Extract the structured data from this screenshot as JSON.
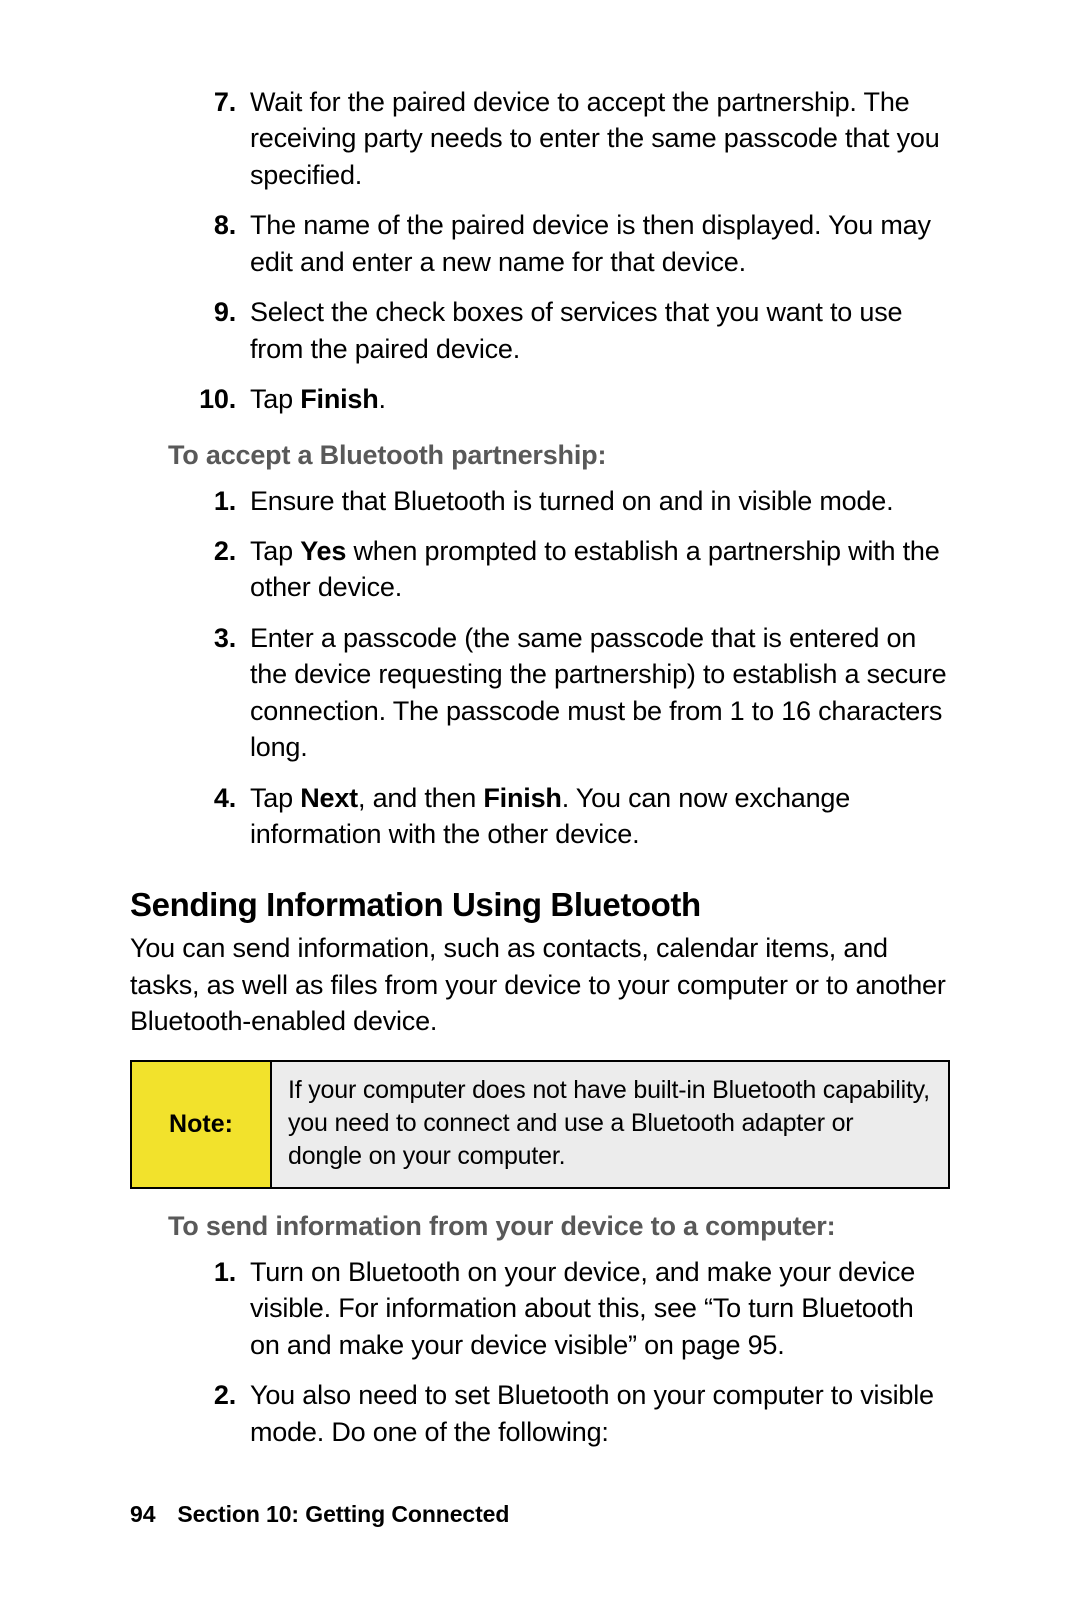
{
  "list1": [
    {
      "n": "7.",
      "t": "Wait for the paired device to accept the partnership. The receiving party needs to enter the same passcode that you specified."
    },
    {
      "n": "8.",
      "t": "The name of the paired device is then displayed.  You may edit and enter a new name for that device."
    },
    {
      "n": "9.",
      "t": "Select the check boxes of services that you want to use from the paired device."
    }
  ],
  "list1_last": {
    "n": "10.",
    "pre": "Tap ",
    "bold": "Finish",
    "post": "."
  },
  "sub1": "To accept a Bluetooth partnership:",
  "list2": {
    "i1": {
      "n": "1.",
      "t": "Ensure that Bluetooth is turned on and in visible mode."
    },
    "i2": {
      "n": "2.",
      "pre": "Tap ",
      "b1": "Yes",
      "post": " when prompted to establish a partnership with the other device."
    },
    "i3": {
      "n": "3.",
      "t": "Enter a passcode (the same passcode that is entered on the device requesting the partnership) to establish a secure connection. The passcode must be from 1 to 16 characters long."
    },
    "i4": {
      "n": "4.",
      "pre": "Tap ",
      "b1": "Next",
      "mid": ", and then ",
      "b2": "Finish",
      "post": ". You can now exchange information with the other device."
    }
  },
  "h2": "Sending Information Using Bluetooth",
  "p1": "You can send information, such as contacts, calendar items, and tasks, as well as files from your device to your computer or to another Bluetooth-enabled device.",
  "note": {
    "label": "Note:",
    "body": "If your computer does not have built-in Bluetooth capability, you need to connect and use a Bluetooth adapter or dongle on your computer."
  },
  "sub2": "To send information from your device to a computer:",
  "list3": {
    "i1": {
      "n": "1.",
      "t": "Turn on Bluetooth on your device, and make your device visible. For information about this, see “To turn Bluetooth on and make your device visible” on page 95."
    },
    "i2": {
      "n": "2.",
      "t": "You also need to set Bluetooth on your computer to visible mode. Do one of the following:"
    }
  },
  "footer": {
    "page": "94",
    "section": "Section 10: Getting Connected"
  }
}
